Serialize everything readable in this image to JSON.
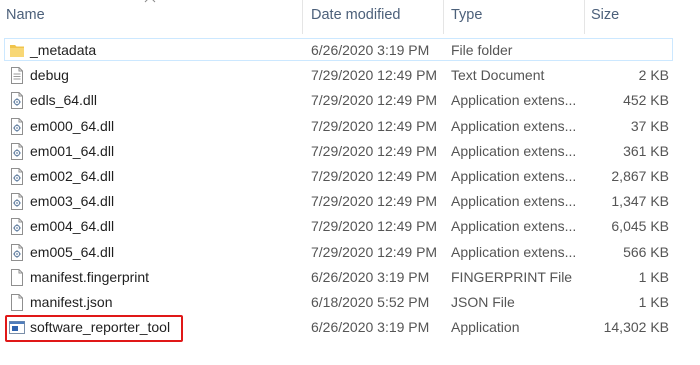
{
  "columns": {
    "name": "Name",
    "date_modified": "Date modified",
    "type": "Type",
    "size": "Size"
  },
  "files": [
    {
      "name": "_metadata",
      "date": "6/26/2020 3:19 PM",
      "type": "File folder",
      "size": "",
      "icon": "folder-icon"
    },
    {
      "name": "debug",
      "date": "7/29/2020 12:49 PM",
      "type": "Text Document",
      "size": "2 KB",
      "icon": "text-document-icon"
    },
    {
      "name": "edls_64.dll",
      "date": "7/29/2020 12:49 PM",
      "type": "Application extens...",
      "size": "452 KB",
      "icon": "dll-icon"
    },
    {
      "name": "em000_64.dll",
      "date": "7/29/2020 12:49 PM",
      "type": "Application extens...",
      "size": "37 KB",
      "icon": "dll-icon"
    },
    {
      "name": "em001_64.dll",
      "date": "7/29/2020 12:49 PM",
      "type": "Application extens...",
      "size": "361 KB",
      "icon": "dll-icon"
    },
    {
      "name": "em002_64.dll",
      "date": "7/29/2020 12:49 PM",
      "type": "Application extens...",
      "size": "2,867 KB",
      "icon": "dll-icon"
    },
    {
      "name": "em003_64.dll",
      "date": "7/29/2020 12:49 PM",
      "type": "Application extens...",
      "size": "1,347 KB",
      "icon": "dll-icon"
    },
    {
      "name": "em004_64.dll",
      "date": "7/29/2020 12:49 PM",
      "type": "Application extens...",
      "size": "6,045 KB",
      "icon": "dll-icon"
    },
    {
      "name": "em005_64.dll",
      "date": "7/29/2020 12:49 PM",
      "type": "Application extens...",
      "size": "566 KB",
      "icon": "dll-icon"
    },
    {
      "name": "manifest.fingerprint",
      "date": "6/26/2020 3:19 PM",
      "type": "FINGERPRINT File",
      "size": "1 KB",
      "icon": "generic-file-icon"
    },
    {
      "name": "manifest.json",
      "date": "6/18/2020 5:52 PM",
      "type": "JSON File",
      "size": "1 KB",
      "icon": "generic-file-icon"
    },
    {
      "name": "software_reporter_tool",
      "date": "6/26/2020 3:19 PM",
      "type": "Application",
      "size": "14,302 KB",
      "icon": "application-icon"
    }
  ],
  "selected_index": 0,
  "highlighted_index": 11,
  "colors": {
    "header_text": "#4c607a",
    "selection_border": "#cce8ff",
    "highlight_box": "#e01818",
    "folder": "#f0c44c"
  }
}
